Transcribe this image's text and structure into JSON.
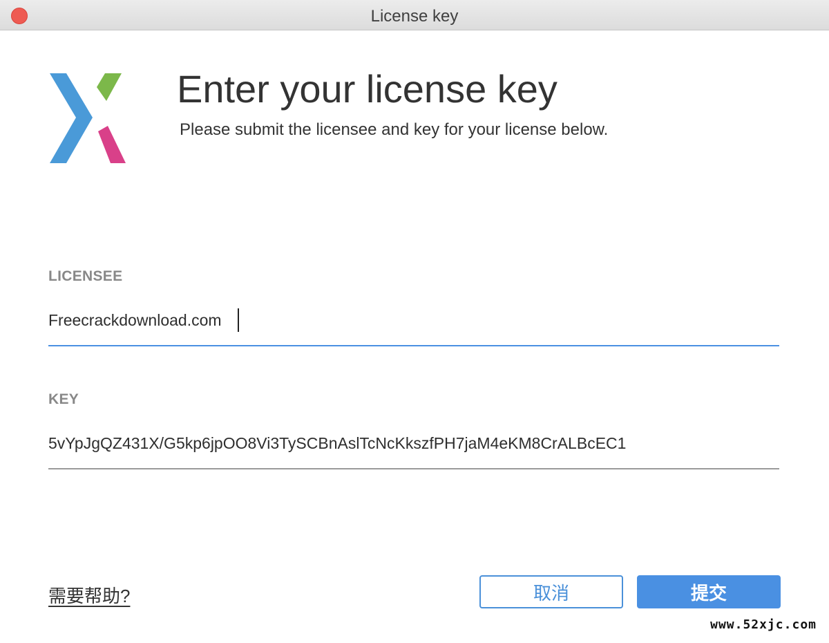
{
  "window": {
    "title": "License key"
  },
  "header": {
    "heading": "Enter your license key",
    "subheading": "Please submit the licensee and key for your license below."
  },
  "licensee": {
    "label": "LICENSEE",
    "value": "Freecrackdownload.com"
  },
  "key": {
    "label": "KEY",
    "value": "5vYpJgQZ431X/G5kp6jpOO8Vi3TySCBnAslTcNcKkszfPH7jaM4eKM8CrALBcEC1"
  },
  "footer": {
    "help_link": "需要帮助?",
    "cancel_label": "取消",
    "submit_label": "提交"
  },
  "watermark": "www.52xjc.com",
  "colors": {
    "accent": "#4a90e2",
    "close_button": "#ee5b53",
    "logo_blue": "#4a9ad8",
    "logo_green": "#7cb84a",
    "logo_pink": "#d94089"
  },
  "icons": {
    "app_logo": "x-chevron-logo-icon"
  }
}
